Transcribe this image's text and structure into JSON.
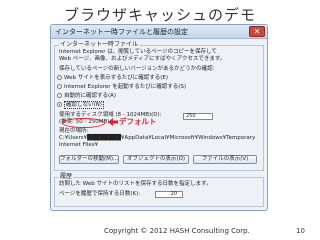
{
  "slide": {
    "title": "ブラウザキャッシュのデモ",
    "copyright": "Copyright © 2012 HASH Consulting Corp.",
    "page_number": "10"
  },
  "dialog": {
    "title": "インターネット一時ファイルと履歴の設定",
    "close_glyph": "✕",
    "temp_files": {
      "group_label": "インターネット一時ファイル",
      "line1": "Internet Explorer は、閲覧しているページのコピーを保存して",
      "line2": "Web ページ、画像、およびメディアにすばやくアクセスできます。",
      "question": "保存しているページの新しいバージョンがあるかどうかの確認:",
      "options": [
        "Web サイトを表示するたびに確認する(E)",
        "Internet Explorer を起動するたびに確認する(S)",
        "自動的に確認する(A)",
        "確認しない(N)"
      ],
      "disk_space_label": "使用するディスク領域 (8 - 1024MB)(D):",
      "disk_space_recommended": "(推奨: 50 - 250MB)",
      "disk_space_value": "250",
      "current_location_label": "現在の場所:",
      "path_line1": "C:¥Users¥████████¥AppData¥Local¥Microsoft¥Windows¥Temporary",
      "path_line2": "Internet Files¥",
      "buttons": [
        "フォルダーの移動(M)...",
        "オブジェクトの表示(O)",
        "ファイルの表示(V)"
      ]
    },
    "history": {
      "group_label": "履歴",
      "line1": "訪問した Web サイトのリストを保存する日数を指定します。",
      "days_label": "ページを履歴で保持する日数(K):",
      "days_value": "20"
    }
  },
  "annotation": {
    "default_label": "デフォルト",
    "color": "#e0202a"
  }
}
